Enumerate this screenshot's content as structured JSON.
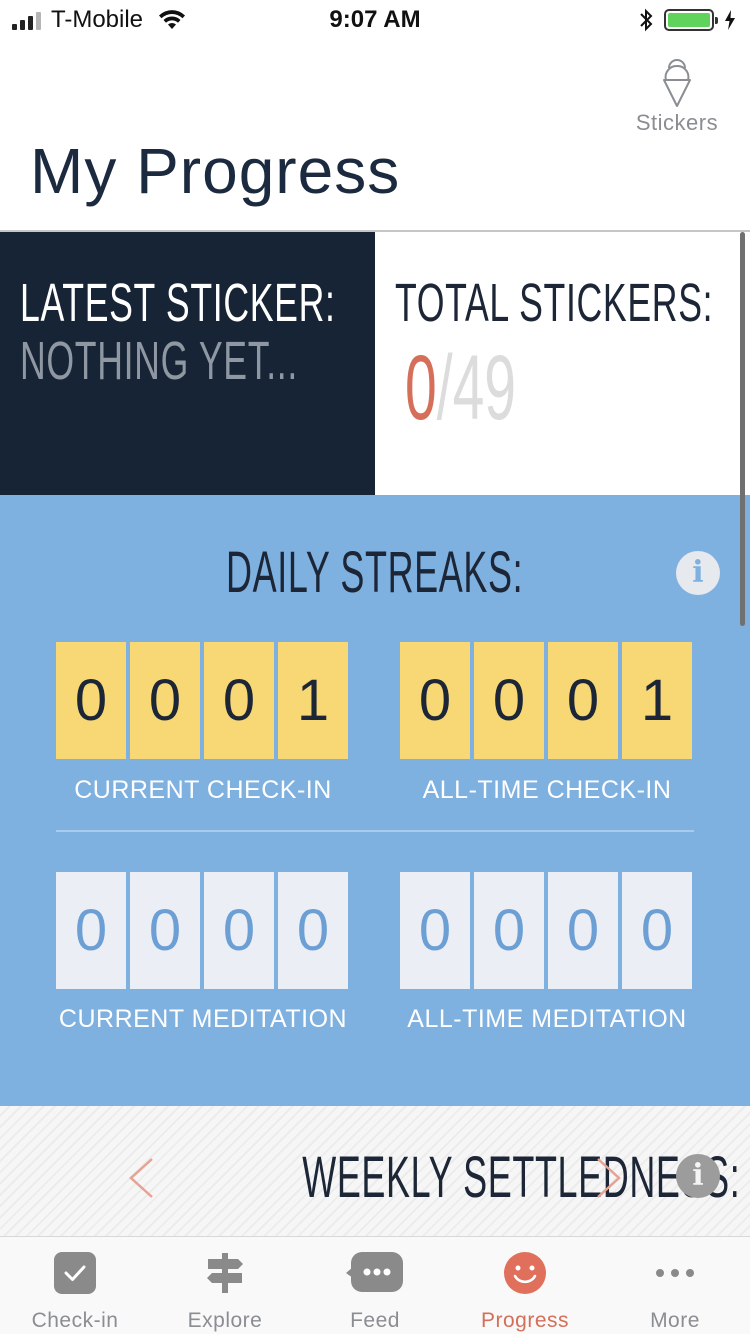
{
  "status_bar": {
    "carrier": "T-Mobile",
    "time": "9:07 AM"
  },
  "header": {
    "title": "My Progress",
    "stickers_button_label": "Stickers"
  },
  "stickers": {
    "latest_heading": "LATEST STICKER:",
    "latest_value": "NOTHING YET...",
    "total_heading": "TOTAL STICKERS:",
    "total_earned": "0",
    "total_separator": "/",
    "total_available": "49"
  },
  "daily_streaks": {
    "heading": "DAILY STREAKS:",
    "current_checkin": {
      "digits": [
        "0",
        "0",
        "0",
        "1"
      ],
      "label": "CURRENT CHECK-IN"
    },
    "alltime_checkin": {
      "digits": [
        "0",
        "0",
        "0",
        "1"
      ],
      "label": "ALL-TIME CHECK-IN"
    },
    "current_meditation": {
      "digits": [
        "0",
        "0",
        "0",
        "0"
      ],
      "label": "CURRENT MEDITATION"
    },
    "alltime_meditation": {
      "digits": [
        "0",
        "0",
        "0",
        "0"
      ],
      "label": "ALL-TIME MEDITATION"
    }
  },
  "weekly": {
    "heading": "WEEKLY SETTLEDNESS:"
  },
  "tabs": [
    {
      "label": "Check-in",
      "icon": "check-in-icon",
      "active": false
    },
    {
      "label": "Explore",
      "icon": "signpost-icon",
      "active": false
    },
    {
      "label": "Feed",
      "icon": "chat-bubble-icon",
      "active": false
    },
    {
      "label": "Progress",
      "icon": "smiley-icon",
      "active": true
    },
    {
      "label": "More",
      "icon": "more-dots-icon",
      "active": false
    }
  ],
  "colors": {
    "navy": "#162435",
    "accent": "#d66f5a",
    "streaks_blue": "#7eb0e0",
    "digit_yellow": "#f7d874",
    "digit_white": "#eceef6"
  }
}
